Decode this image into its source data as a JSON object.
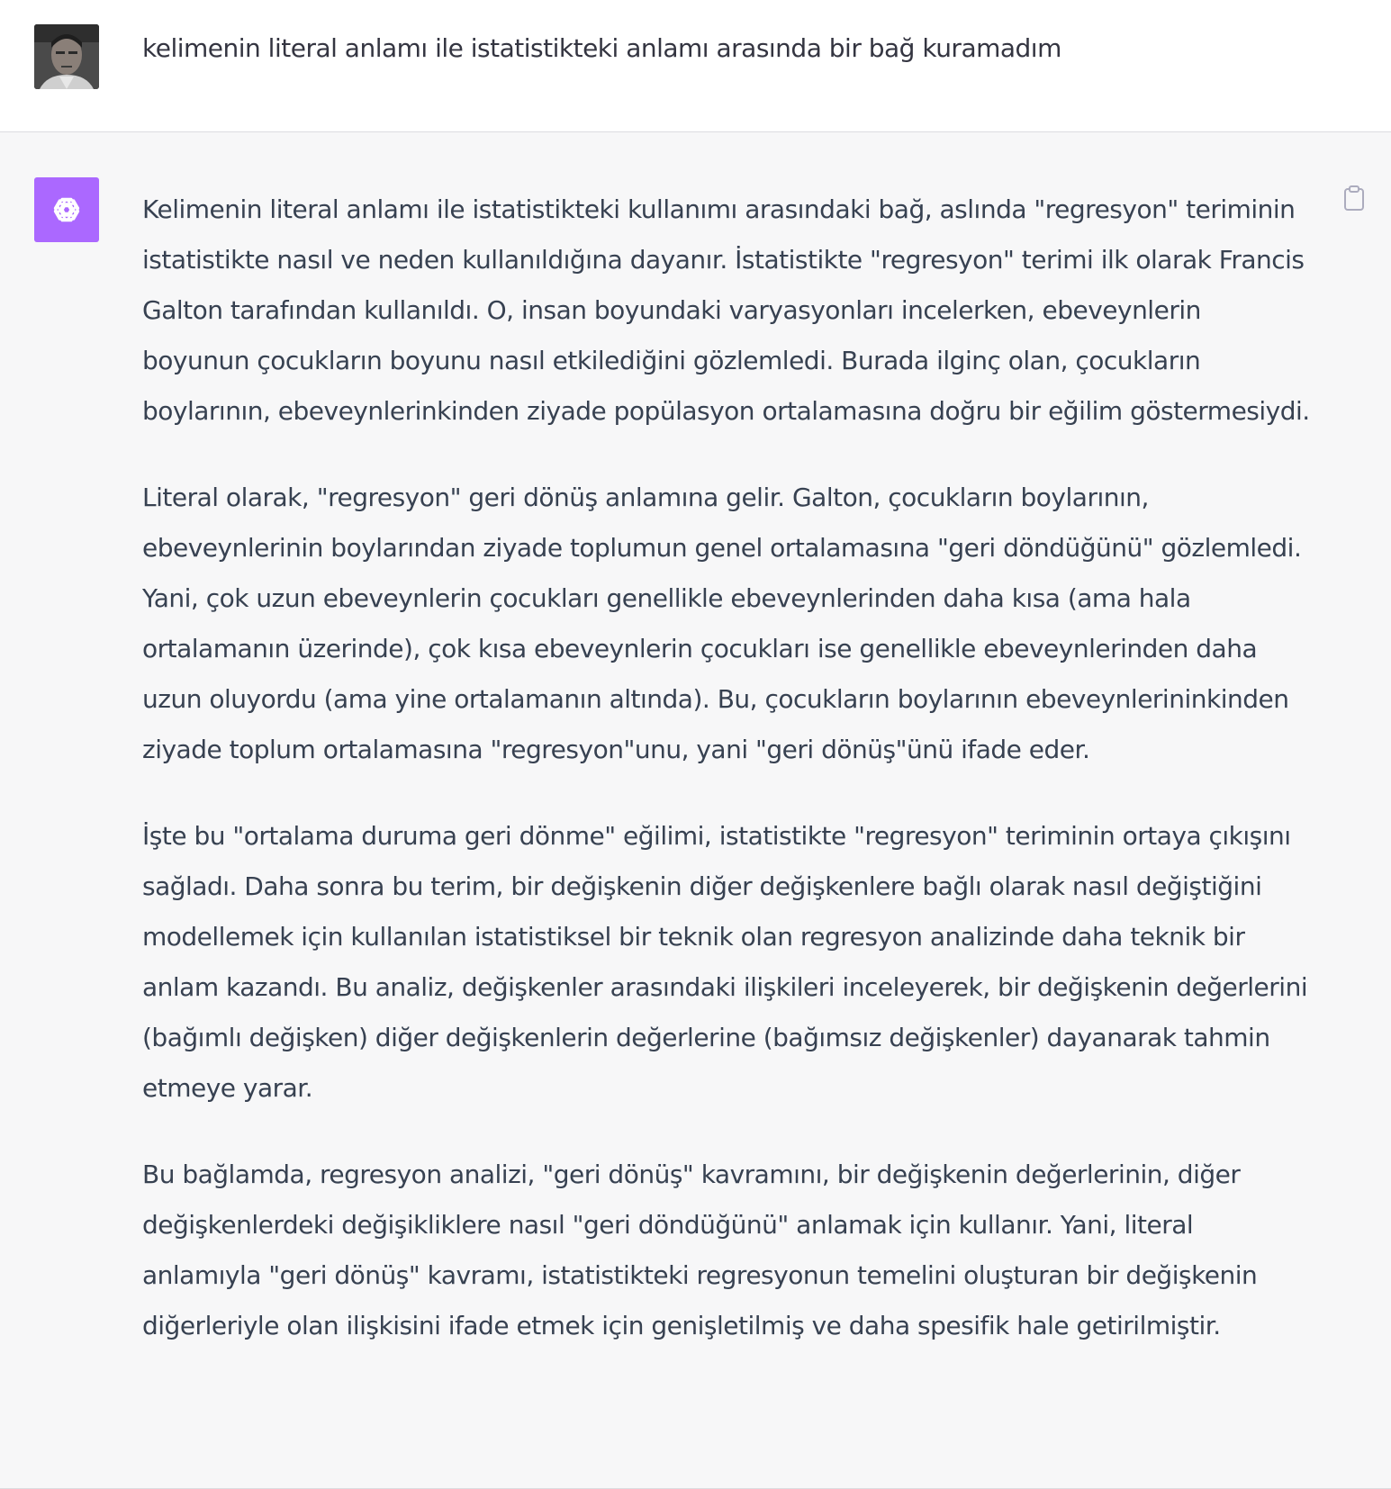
{
  "user_message": {
    "text": "kelimenin literal anlamı ile istatistikteki anlamı arasında bir bağ kuramadım"
  },
  "assistant_message": {
    "paragraphs": [
      "Kelimenin literal anlamı ile istatistikteki kullanımı arasındaki bağ, aslında \"regresyon\" teriminin istatistikte nasıl ve neden kullanıldığına dayanır. İstatistikte \"regresyon\" terimi ilk olarak Francis Galton tarafından kullanıldı. O, insan boyundaki varyasyonları incelerken, ebeveynlerin boyunun çocukların boyunu nasıl etkilediğini gözlemledi. Burada ilginç olan, çocukların boylarının, ebeveynlerinkinden ziyade popülasyon ortalamasına doğru bir eğilim göstermesiydi.",
      "Literal olarak, \"regresyon\" geri dönüş anlamına gelir. Galton, çocukların boylarının, ebeveynlerinin boylarından ziyade toplumun genel ortalamasına \"geri döndüğünü\" gözlemledi. Yani, çok uzun ebeveynlerin çocukları genellikle ebeveynlerinden daha kısa (ama hala ortalamanın üzerinde), çok kısa ebeveynlerin çocukları ise genellikle ebeveynlerinden daha uzun oluyordu (ama yine ortalamanın altında). Bu, çocukların boylarının ebeveynlerininkinden ziyade toplum ortalamasına \"regresyon\"unu, yani \"geri dönüş\"ünü ifade eder.",
      "İşte bu \"ortalama duruma geri dönme\" eğilimi, istatistikte \"regresyon\" teriminin ortaya çıkışını sağladı. Daha sonra bu terim, bir değişkenin diğer değişkenlere bağlı olarak nasıl değiştiğini modellemek için kullanılan istatistiksel bir teknik olan regresyon analizinde daha teknik bir anlam kazandı. Bu analiz, değişkenler arasındaki ilişkileri inceleyerek, bir değişkenin değerlerini (bağımlı değişken) diğer değişkenlerin değerlerine (bağımsız değişkenler) dayanarak tahmin etmeye yarar.",
      "Bu bağlamda, regresyon analizi, \"geri dönüş\" kavramını, bir değişkenin değerlerinin, diğer değişkenlerdeki değişikliklere nasıl \"geri döndüğünü\" anlamak için kullanır. Yani, literal anlamıyla \"geri dönüş\" kavramı, istatistikteki regresyonun temelini oluşturan bir değişkenin diğerleriyle olan ilişkisini ifade etmek için genişletilmiş ve daha spesifik hale getirilmiştir."
    ]
  },
  "icons": {
    "user_avatar": "user-photo-avatar",
    "assistant_avatar": "openai-logo-icon",
    "copy": "clipboard-icon"
  },
  "colors": {
    "assistant_avatar_bg": "#ab68ff",
    "assistant_row_bg": "#f7f7f8",
    "text": "#374151"
  }
}
